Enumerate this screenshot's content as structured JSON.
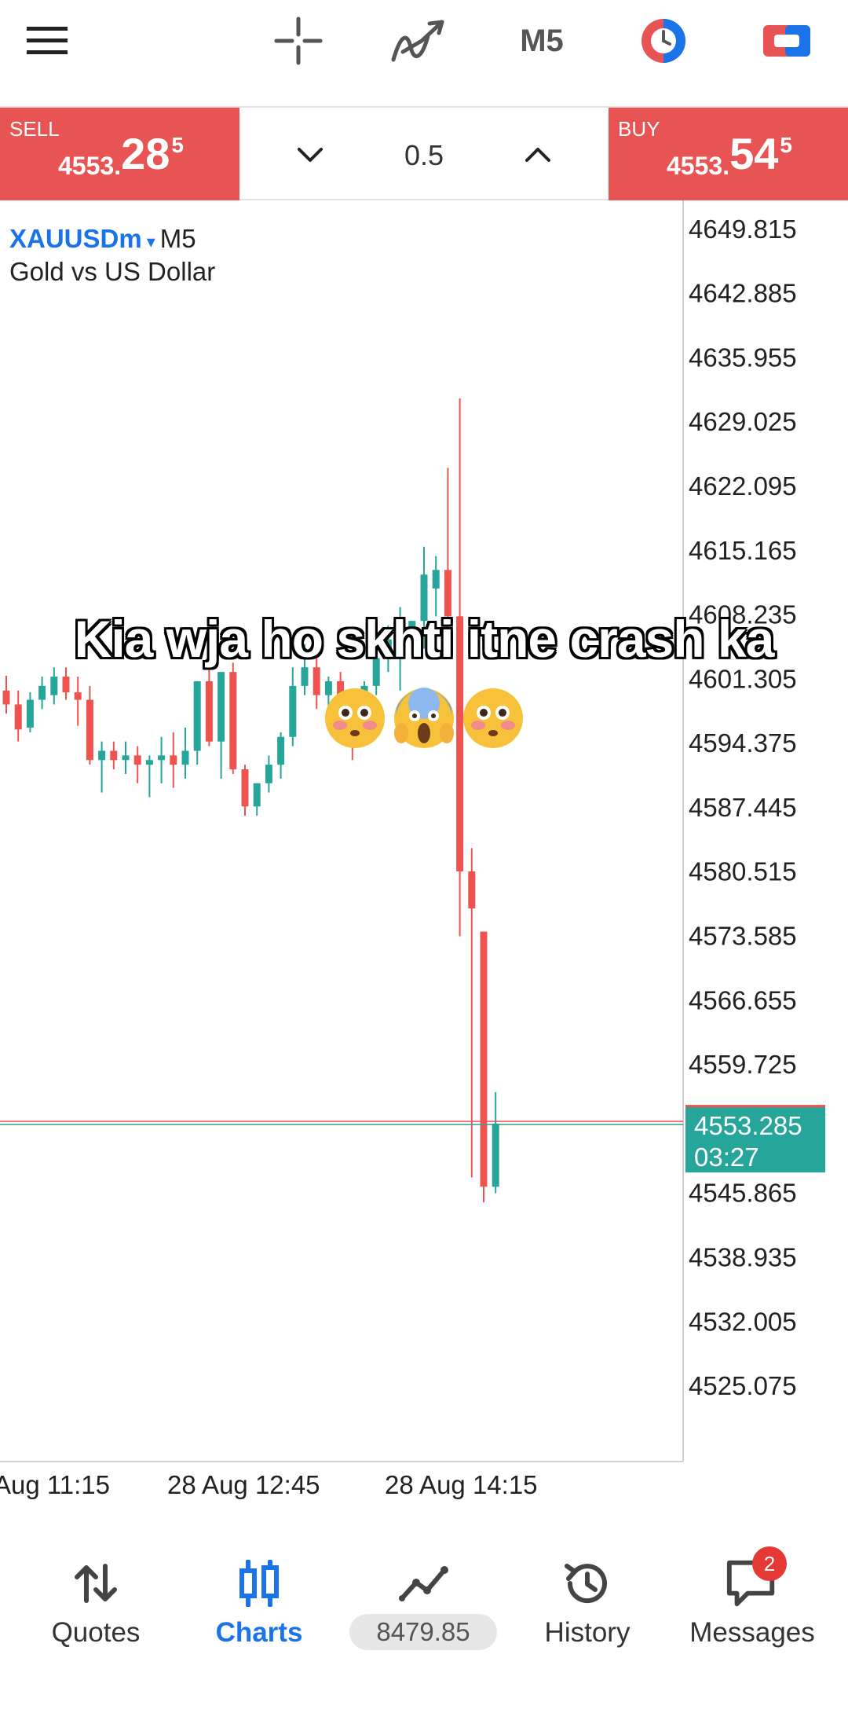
{
  "toolbar": {
    "timeframe": "M5",
    "icons": [
      "menu-icon",
      "crosshair-icon",
      "indicators-icon",
      "timeframe-button",
      "one-click-trading-icon",
      "trade-toggle-icon"
    ]
  },
  "tradebar": {
    "sell_label": "SELL",
    "sell_small": "4553.",
    "sell_big": "28",
    "sell_sup": "5",
    "buy_label": "BUY",
    "buy_small": "4553.",
    "buy_big": "54",
    "buy_sup": "5",
    "lot": "0.5"
  },
  "chart": {
    "symbol": "XAUUSDm",
    "symbol_caret": "▾",
    "timeframe": "M5",
    "description": "Gold vs US Dollar",
    "price_levels": [
      "4649.815",
      "4642.885",
      "4635.955",
      "4629.025",
      "4622.095",
      "4615.165",
      "4608.235",
      "4601.305",
      "4594.375",
      "4587.445",
      "4580.515",
      "4573.585",
      "4566.655",
      "4559.725",
      "4545.865",
      "4538.935",
      "4532.005",
      "4525.075"
    ],
    "current_price": "4553.285",
    "current_time": "03:27",
    "time_labels": [
      "Aug 11:15",
      "28 Aug 12:45",
      "28 Aug 14:15"
    ],
    "more": "•••",
    "colors": {
      "bull": "#26a69a",
      "bear": "#ef5350",
      "label_bg": "#26a69a"
    }
  },
  "chart_data": {
    "type": "candlestick",
    "y_axis_labels": [
      "4649.815",
      "4642.885",
      "4635.955",
      "4629.025",
      "4622.095",
      "4615.165",
      "4608.235",
      "4601.305",
      "4594.375",
      "4587.445",
      "4580.515",
      "4573.585",
      "4566.655",
      "4559.725",
      "4545.865",
      "4538.935",
      "4532.005",
      "4525.075"
    ],
    "x_axis_labels": [
      "Aug 11:15",
      "28 Aug 12:45",
      "28 Aug 14:15"
    ],
    "ylim": [
      4520,
      4652
    ],
    "last_price": 4553.285,
    "candles": [
      {
        "o": 4600.0,
        "h": 4601.6,
        "l": 4597.5,
        "c": 4598.5
      },
      {
        "o": 4598.5,
        "h": 4600.0,
        "l": 4594.5,
        "c": 4595.8
      },
      {
        "o": 4596.0,
        "h": 4599.8,
        "l": 4595.5,
        "c": 4599.0
      },
      {
        "o": 4599.0,
        "h": 4601.5,
        "l": 4598.0,
        "c": 4600.5
      },
      {
        "o": 4599.5,
        "h": 4602.5,
        "l": 4598.5,
        "c": 4601.5
      },
      {
        "o": 4601.5,
        "h": 4602.5,
        "l": 4599.0,
        "c": 4599.8
      },
      {
        "o": 4599.8,
        "h": 4601.5,
        "l": 4596.2,
        "c": 4599.0
      },
      {
        "o": 4599.0,
        "h": 4600.5,
        "l": 4592.0,
        "c": 4592.5
      },
      {
        "o": 4592.5,
        "h": 4594.5,
        "l": 4589.0,
        "c": 4593.5
      },
      {
        "o": 4593.5,
        "h": 4594.5,
        "l": 4591.5,
        "c": 4592.5
      },
      {
        "o": 4592.5,
        "h": 4594.5,
        "l": 4591.0,
        "c": 4593.0
      },
      {
        "o": 4593.0,
        "h": 4594.0,
        "l": 4590.0,
        "c": 4592.0
      },
      {
        "o": 4592.0,
        "h": 4593.0,
        "l": 4588.5,
        "c": 4592.5
      },
      {
        "o": 4592.5,
        "h": 4595.0,
        "l": 4590.0,
        "c": 4593.0
      },
      {
        "o": 4593.0,
        "h": 4595.5,
        "l": 4589.5,
        "c": 4592.0
      },
      {
        "o": 4592.0,
        "h": 4596.0,
        "l": 4590.5,
        "c": 4593.5
      },
      {
        "o": 4593.5,
        "h": 4601.0,
        "l": 4592.0,
        "c": 4601.0
      },
      {
        "o": 4601.0,
        "h": 4604.0,
        "l": 4594.0,
        "c": 4594.5
      },
      {
        "o": 4594.5,
        "h": 4602.0,
        "l": 4590.5,
        "c": 4602.0
      },
      {
        "o": 4602.0,
        "h": 4603.0,
        "l": 4591.0,
        "c": 4591.5
      },
      {
        "o": 4591.5,
        "h": 4592.0,
        "l": 4586.5,
        "c": 4587.5
      },
      {
        "o": 4587.5,
        "h": 4590.0,
        "l": 4586.5,
        "c": 4590.0
      },
      {
        "o": 4590.0,
        "h": 4593.0,
        "l": 4589.0,
        "c": 4592.0
      },
      {
        "o": 4592.0,
        "h": 4595.5,
        "l": 4590.5,
        "c": 4595.0
      },
      {
        "o": 4595.0,
        "h": 4602.5,
        "l": 4594.0,
        "c": 4600.5
      },
      {
        "o": 4600.5,
        "h": 4605.0,
        "l": 4599.5,
        "c": 4602.5
      },
      {
        "o": 4602.5,
        "h": 4606.0,
        "l": 4598.0,
        "c": 4599.5
      },
      {
        "o": 4599.5,
        "h": 4601.5,
        "l": 4597.5,
        "c": 4601.0
      },
      {
        "o": 4601.0,
        "h": 4602.0,
        "l": 4596.5,
        "c": 4598.0
      },
      {
        "o": 4598.0,
        "h": 4599.5,
        "l": 4592.5,
        "c": 4597.5
      },
      {
        "o": 4597.5,
        "h": 4601.0,
        "l": 4596.5,
        "c": 4600.5
      },
      {
        "o": 4600.5,
        "h": 4605.0,
        "l": 4599.5,
        "c": 4603.5
      },
      {
        "o": 4603.5,
        "h": 4607.0,
        "l": 4602.0,
        "c": 4605.5
      },
      {
        "o": 4605.5,
        "h": 4609.0,
        "l": 4600.0,
        "c": 4606.5
      },
      {
        "o": 4606.5,
        "h": 4607.5,
        "l": 4603.5,
        "c": 4607.5
      },
      {
        "o": 4607.5,
        "h": 4615.5,
        "l": 4604.5,
        "c": 4612.5
      },
      {
        "o": 4611.0,
        "h": 4614.5,
        "l": 4608.0,
        "c": 4613.0
      },
      {
        "o": 4613.0,
        "h": 4624.0,
        "l": 4607.0,
        "c": 4608.0
      },
      {
        "o": 4608.0,
        "h": 4631.5,
        "l": 4573.5,
        "c": 4580.5
      },
      {
        "o": 4580.5,
        "h": 4583.0,
        "l": 4547.5,
        "c": 4576.5
      },
      {
        "o": 4574.0,
        "h": 4574.0,
        "l": 4544.8,
        "c": 4546.5
      },
      {
        "o": 4546.5,
        "h": 4556.7,
        "l": 4545.8,
        "c": 4553.3
      }
    ]
  },
  "overlay": {
    "caption": "Kia wja ho skhti itne crash ka",
    "emojis": [
      "flushed-face-emoji",
      "screaming-face-emoji",
      "flushed-face-emoji"
    ]
  },
  "bottomnav": {
    "items": [
      {
        "label": "Quotes",
        "icon": "quotes-icon"
      },
      {
        "label": "Charts",
        "icon": "charts-icon"
      },
      {
        "label": "",
        "icon": "trade-icon"
      },
      {
        "label": "History",
        "icon": "history-icon"
      },
      {
        "label": "Messages",
        "icon": "messages-icon"
      }
    ],
    "equity": "8479.85",
    "messages_badge": "2",
    "accent": "#1a73e8"
  }
}
